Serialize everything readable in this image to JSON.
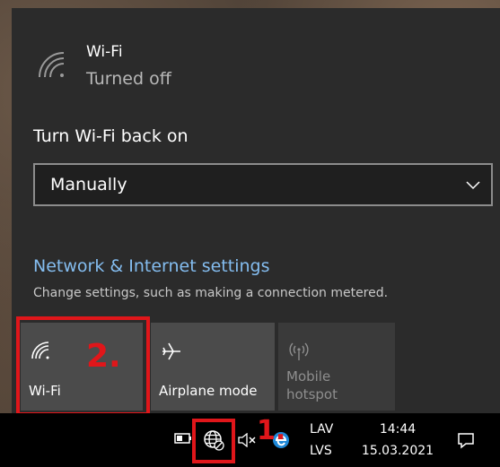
{
  "wifi": {
    "name": "Wi-Fi",
    "status": "Turned off",
    "icon": "wifi-off-icon"
  },
  "turn_back": {
    "label": "Turn Wi-Fi back on",
    "selected": "Manually"
  },
  "network_settings": {
    "link": "Network & Internet settings",
    "description": "Change settings, such as making a connection metered."
  },
  "quick_actions": [
    {
      "label": "Wi-Fi",
      "icon": "wifi-icon",
      "state": "off"
    },
    {
      "label": "Airplane mode",
      "icon": "airplane-icon",
      "state": "off"
    },
    {
      "label": "Mobile\nhotspot",
      "icon": "hotspot-icon",
      "state": "disabled"
    }
  ],
  "annotations": {
    "step1": "1.",
    "step2": "2.",
    "color": "#e0161a"
  },
  "taskbar": {
    "lang_top": "LAV",
    "lang_bottom": "LVS",
    "time": "14:44",
    "date": "15.03.2021"
  },
  "colors": {
    "flyout_bg": "#2b2b2b",
    "link": "#84bdf0",
    "tile_bg": "#4b4b4b"
  }
}
